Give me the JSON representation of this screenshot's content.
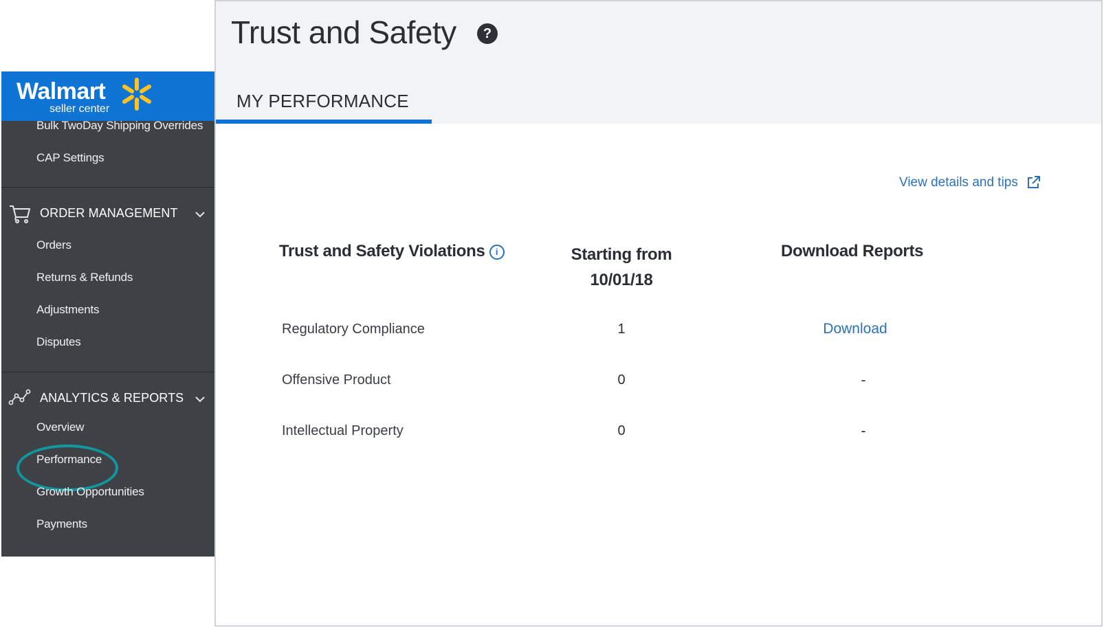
{
  "brand": {
    "name": "Walmart",
    "subtitle": "seller center",
    "accent": "#0f74d4",
    "spark_color": "#ffc220"
  },
  "sidebar": {
    "items_top": [
      {
        "label": "Bulk TwoDay Shipping Overrides"
      },
      {
        "label": "CAP Settings"
      }
    ],
    "order_management": {
      "title": "ORDER MANAGEMENT",
      "icon": "cart-icon",
      "items": [
        {
          "label": "Orders"
        },
        {
          "label": "Returns & Refunds"
        },
        {
          "label": "Adjustments"
        },
        {
          "label": "Disputes"
        }
      ]
    },
    "analytics_reports": {
      "title": "ANALYTICS & REPORTS",
      "icon": "line-graph-icon",
      "items": [
        {
          "label": "Overview"
        },
        {
          "label": "Performance",
          "highlighted": true
        },
        {
          "label": "Growth Opportunities"
        },
        {
          "label": "Payments"
        }
      ]
    },
    "highlight_color": "#12979f"
  },
  "page": {
    "title": "Trust and Safety",
    "help_glyph": "?",
    "tab_label": "MY PERFORMANCE",
    "details_link": "View details and tips"
  },
  "table": {
    "columns": {
      "violations": "Trust and Safety Violations",
      "starting_line1": "Starting from",
      "starting_line2": "10/01/18",
      "reports": "Download Reports"
    },
    "info_glyph": "i",
    "rows": [
      {
        "label": "Regulatory Compliance",
        "value": "1",
        "report": "Download"
      },
      {
        "label": "Offensive Product",
        "value": "0",
        "report": "-"
      },
      {
        "label": "Intellectual Property",
        "value": "0",
        "report": "-"
      }
    ]
  }
}
